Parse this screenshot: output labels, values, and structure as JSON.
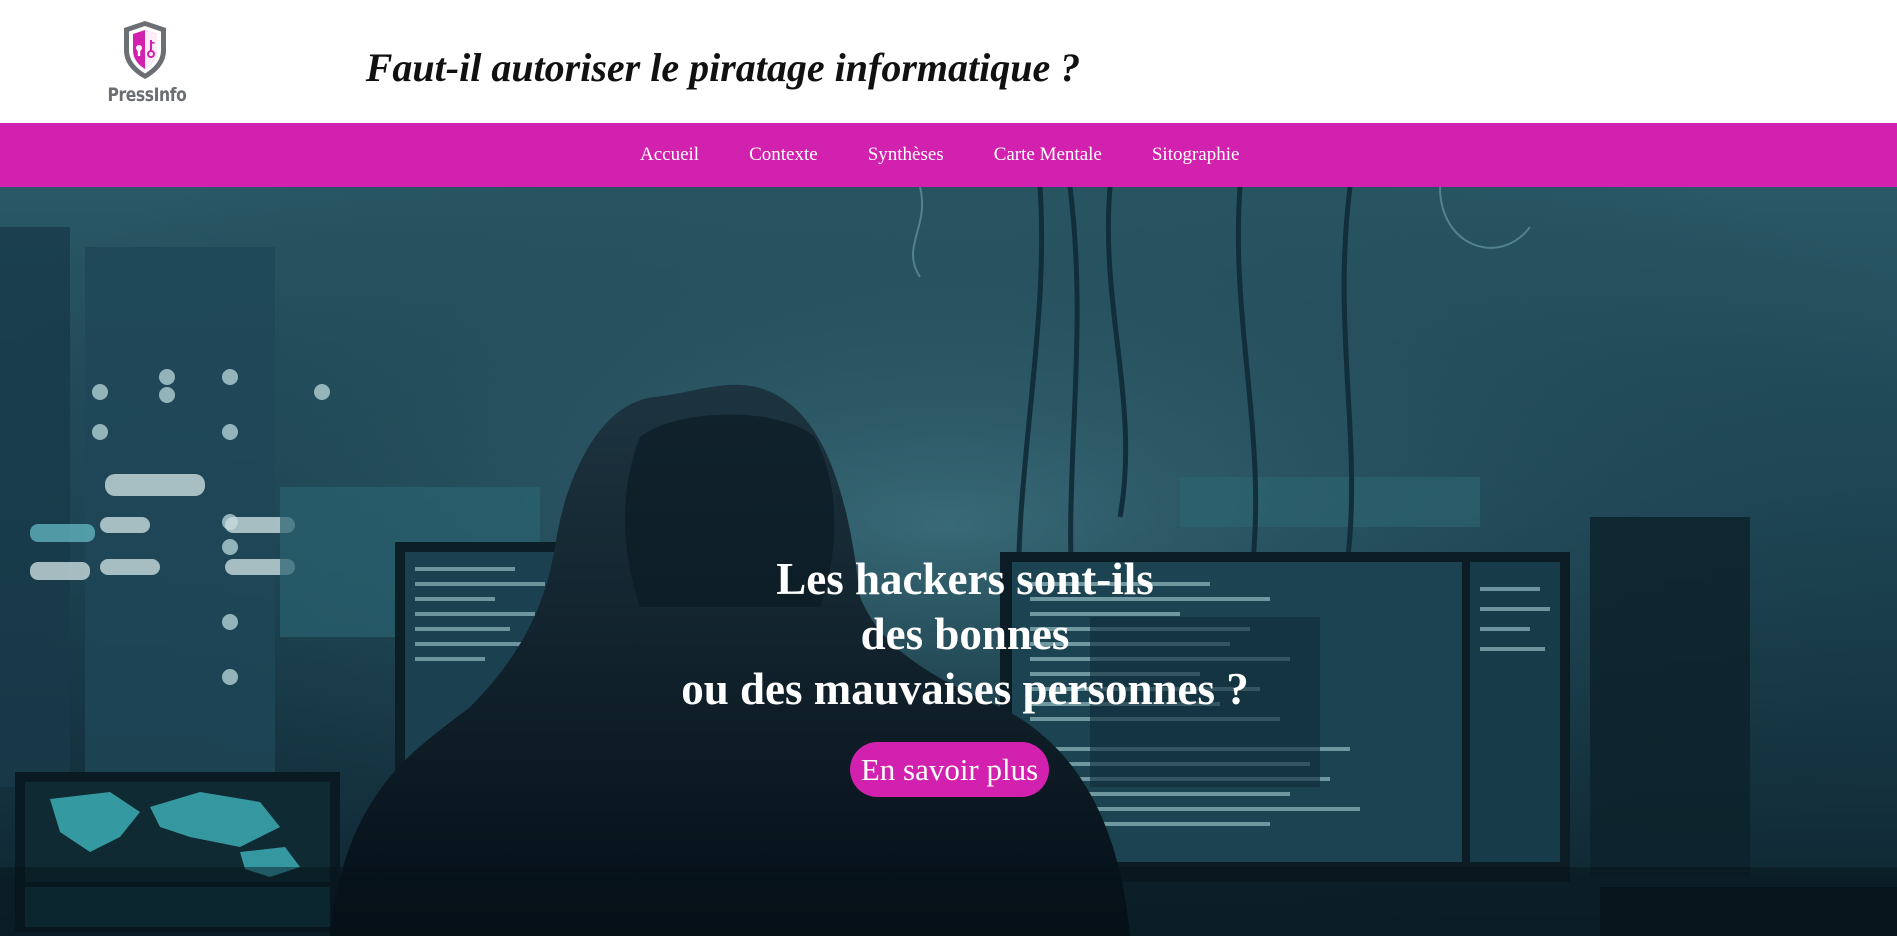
{
  "brand": {
    "logo_text": "PressInfo",
    "accent_color": "#d321af",
    "logo_icon": "shield-lock-icon"
  },
  "header": {
    "title": "Faut-il autoriser le piratage informatique ?"
  },
  "nav": {
    "items": [
      {
        "label": "Accueil"
      },
      {
        "label": "Contexte"
      },
      {
        "label": "Synthèses"
      },
      {
        "label": "Carte Mentale"
      },
      {
        "label": "Sitographie"
      }
    ]
  },
  "hero": {
    "title_line1": "Les hackers sont-ils des bonnes",
    "title_line2": "ou des mauvaises personnes ?",
    "cta_label": "En savoir plus",
    "background": "hooded-hacker-at-monitors-image"
  }
}
